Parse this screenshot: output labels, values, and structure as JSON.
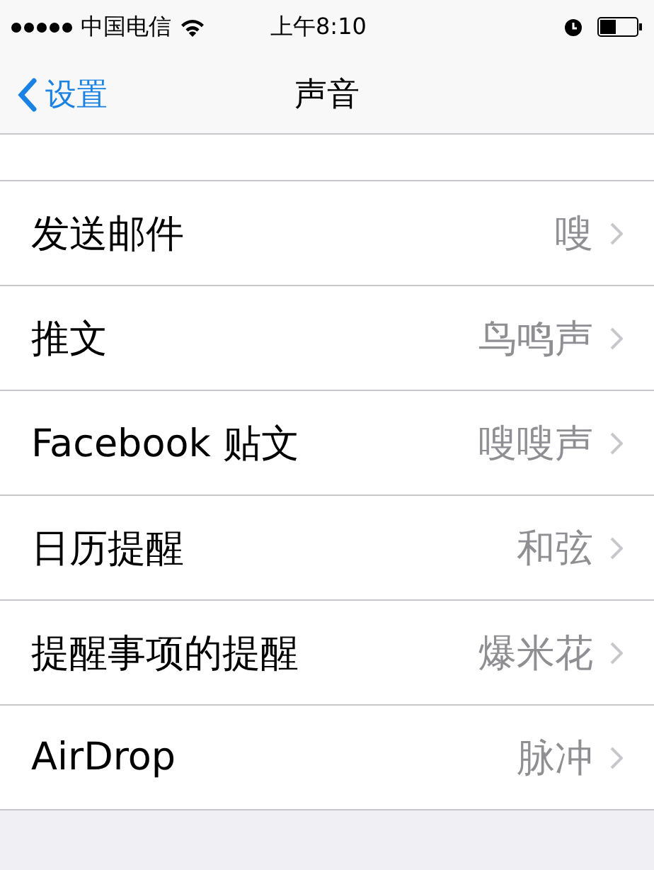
{
  "status_bar": {
    "carrier": "中国电信",
    "time": "上午8:10"
  },
  "nav": {
    "back": "设置",
    "title": "声音"
  },
  "rows": [
    {
      "label": "发送邮件",
      "value": "嗖"
    },
    {
      "label": "推文",
      "value": "鸟鸣声"
    },
    {
      "label": "Facebook 贴文",
      "value": "嗖嗖声"
    },
    {
      "label": "日历提醒",
      "value": "和弦"
    },
    {
      "label": "提醒事项的提醒",
      "value": "爆米花"
    },
    {
      "label": "AirDrop",
      "value": "脉冲"
    }
  ]
}
